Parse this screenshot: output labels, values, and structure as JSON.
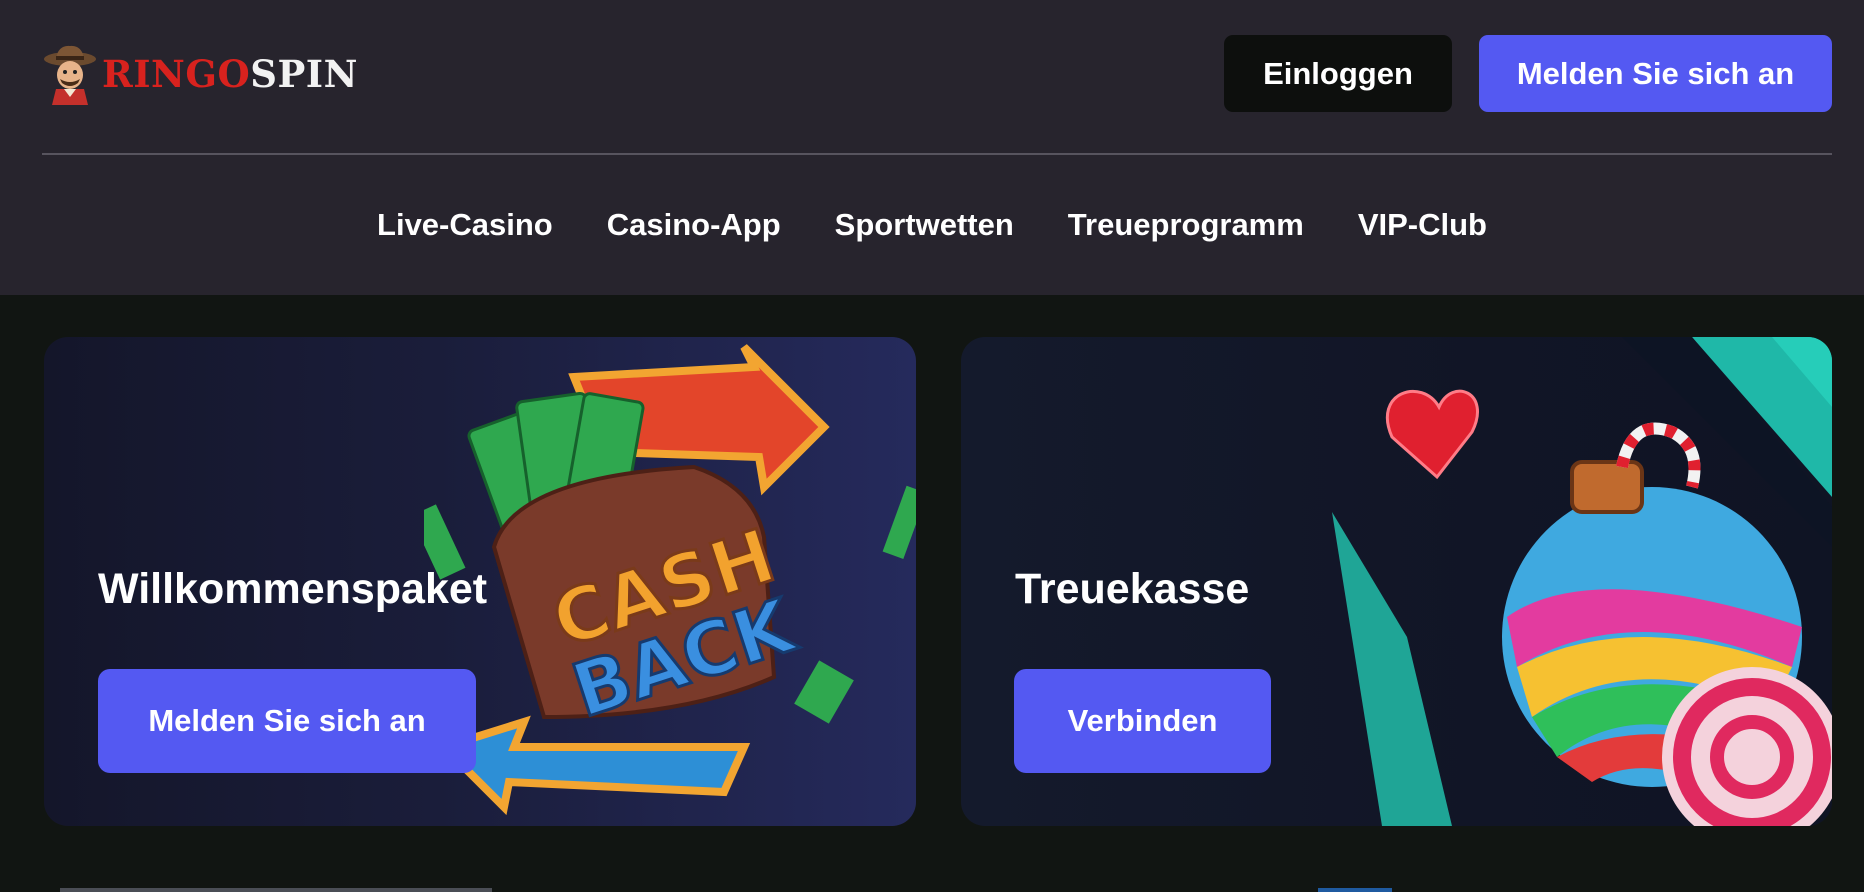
{
  "header": {
    "logo": {
      "part1": "RINGO",
      "part2": "SPIN"
    },
    "login_label": "Einloggen",
    "register_label": "Melden Sie sich an"
  },
  "nav": {
    "items": [
      {
        "label": "Live-Casino"
      },
      {
        "label": "Casino-App"
      },
      {
        "label": "Sportwetten"
      },
      {
        "label": "Treueprogramm"
      },
      {
        "label": "VIP-Club"
      }
    ]
  },
  "promos": [
    {
      "title": "Willkommenspaket",
      "button": "Melden Sie sich an",
      "art_text": [
        "CASH",
        "BACK"
      ]
    },
    {
      "title": "Treuekasse",
      "button": "Verbinden"
    }
  ],
  "colors": {
    "accent": "#5459f2",
    "header_bg": "#27242d",
    "page_bg": "#111512",
    "login_bg": "#0d0f0d",
    "logo_red": "#d8221e"
  }
}
